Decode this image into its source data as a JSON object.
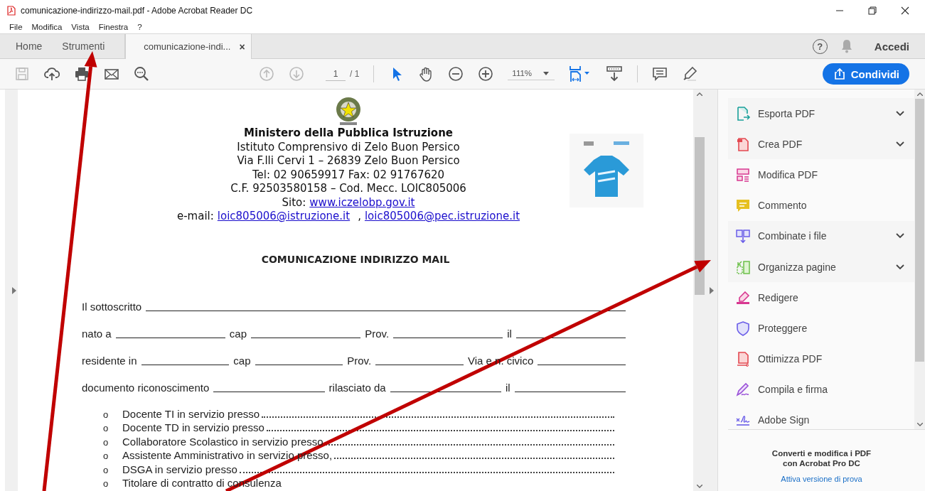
{
  "window": {
    "title": "comunicazione-indirizzo-mail.pdf - Adobe Acrobat Reader DC"
  },
  "menu_bar": [
    "File",
    "Modifica",
    "Vista",
    "Finestra",
    "?"
  ],
  "tabs": [
    {
      "label": "Home",
      "selected": false,
      "closable": false
    },
    {
      "label": "Strumenti",
      "selected": false,
      "closable": false
    },
    {
      "label": "comunicazione-indi...",
      "selected": true,
      "closable": true
    }
  ],
  "close_tab_glyph": "×",
  "account": {
    "help_glyph": "?",
    "sign_in": "Accedi"
  },
  "toolbar": {
    "tools": [
      {
        "disabled": true
      },
      {
        "disabled": false
      },
      {
        "disabled": false
      },
      {
        "disabled": false
      },
      {
        "disabled": false
      }
    ],
    "nav": [
      {
        "disabled": true
      },
      {
        "disabled": true
      }
    ],
    "page": "1",
    "page_total": "/ 1",
    "modes": [
      {
        "selected": true
      },
      {
        "selected": false
      },
      {
        "selected": false
      },
      {
        "selected": false
      }
    ],
    "zoom": "111%",
    "share_button": "Condividi"
  },
  "document": {
    "header": [
      "Ministero della Pubblica Istruzione",
      "Istituto Comprensivo di Zelo Buon Persico",
      "Via F.lli Cervi 1 – 26839 Zelo Buon Persico",
      "Tel: 02 90659917 Fax: 02 91767620",
      "C.F. 92503580158 – Cod. Mecc. LOIC805006"
    ],
    "site_label": "Sito:",
    "site_link": "www.iczelobp.gov.it",
    "email_label": "e-mail:",
    "email_links": [
      "loic805006@istruzione.it",
      "loic805006@pec.istruzione.it"
    ],
    "email_sep": ",",
    "title": "COMUNICAZIONE INDIRIZZO MAIL",
    "form_rows": [
      [
        {
          "kind": "text",
          "text": "Il sottoscritto"
        },
        {
          "kind": "blank"
        }
      ],
      [
        {
          "kind": "text",
          "text": "nato a"
        },
        {
          "kind": "blank"
        },
        {
          "kind": "text",
          "text": "cap"
        },
        {
          "kind": "blank"
        },
        {
          "kind": "text",
          "text": "Prov."
        },
        {
          "kind": "blank"
        },
        {
          "kind": "text",
          "text": "il"
        },
        {
          "kind": "blank"
        }
      ],
      [
        {
          "kind": "text",
          "text": "residente in"
        },
        {
          "kind": "blank"
        },
        {
          "kind": "text",
          "text": "cap"
        },
        {
          "kind": "blank"
        },
        {
          "kind": "text",
          "text": "Prov."
        },
        {
          "kind": "blank"
        },
        {
          "kind": "text",
          "text": "Via e n. civico"
        },
        {
          "kind": "blank"
        }
      ],
      [
        {
          "kind": "text",
          "text": "documento riconoscimento"
        },
        {
          "kind": "blank"
        },
        {
          "kind": "text",
          "text": "rilasciato da"
        },
        {
          "kind": "blank"
        },
        {
          "kind": "text",
          "text": "il"
        },
        {
          "kind": "blank"
        }
      ]
    ],
    "options": [
      {
        "bullet": "o",
        "text": "Docente TI in servizio presso",
        "leader": true
      },
      {
        "bullet": "o",
        "text": "Docente TD in servizio presso",
        "leader": true
      },
      {
        "bullet": "o",
        "text": "Collaboratore Scolastico in servizio presso",
        "leader": true
      },
      {
        "bullet": "o",
        "text": "Assistente Amministrativo in servizio presso,",
        "leader": true
      },
      {
        "bullet": "o",
        "text": "DSGA in servizio presso",
        "leader": true
      },
      {
        "bullet": "o",
        "text": "Titolare di contratto di consulenza",
        "leader": false
      }
    ]
  },
  "tools_panel": {
    "items": [
      {
        "label": "Esporta PDF",
        "expandable": true
      },
      {
        "label": "Crea PDF",
        "expandable": true
      },
      {
        "label": "Modifica PDF",
        "expandable": false
      },
      {
        "label": "Commento",
        "expandable": false
      },
      {
        "label": "Combinate i file",
        "expandable": true
      },
      {
        "label": "Organizza pagine",
        "expandable": true
      },
      {
        "label": "Redigere",
        "expandable": false
      },
      {
        "label": "Proteggere",
        "expandable": false
      },
      {
        "label": "Ottimizza PDF",
        "expandable": false
      },
      {
        "label": "Compila e firma",
        "expandable": false
      },
      {
        "label": "Adobe Sign",
        "expandable": false
      }
    ],
    "promo": [
      "Converti e modifica i PDF",
      "con Acrobat Pro DC"
    ],
    "promo_link": "Attiva versione di prova"
  },
  "annotations": [
    {
      "kind": "arrow"
    },
    {
      "kind": "arrow"
    }
  ]
}
